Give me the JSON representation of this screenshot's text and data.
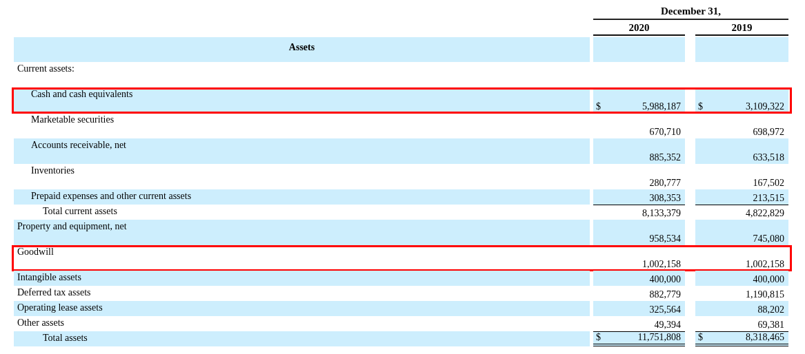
{
  "table": {
    "period_heading": "December 31,",
    "columns": [
      "2020",
      "2019"
    ],
    "rows": [
      {
        "kind": "heading",
        "label": "Assets",
        "highlighted": false
      },
      {
        "kind": "tall",
        "label": "Current assets:",
        "highlighted": false,
        "children": [
          {
            "kind": "tall",
            "label": "Cash and cash equivalents",
            "highlighted": true,
            "values": [
              {
                "sign": "$",
                "amount": "5,988,187"
              },
              {
                "sign": "$",
                "amount": "3,109,322"
              }
            ]
          },
          {
            "kind": "tall",
            "label": "Marketable securities",
            "highlighted": false,
            "values": [
              {
                "amount": "670,710"
              },
              {
                "amount": "698,972"
              }
            ]
          },
          {
            "kind": "tall",
            "label": "Accounts receivable, net",
            "highlighted": false,
            "values": [
              {
                "amount": "885,352"
              },
              {
                "amount": "633,518"
              }
            ]
          },
          {
            "kind": "tall",
            "label": "Inventories",
            "highlighted": false,
            "values": [
              {
                "amount": "280,777"
              },
              {
                "amount": "167,502"
              }
            ]
          },
          {
            "kind": "short",
            "label": "Prepaid expenses and other current assets",
            "highlighted": false,
            "values": [
              {
                "amount": "308,353"
              },
              {
                "amount": "213,515"
              }
            ]
          }
        ]
      },
      {
        "kind": "subtotal",
        "label": "Total current assets",
        "highlighted": false,
        "values": [
          {
            "amount": "8,133,379"
          },
          {
            "amount": "4,822,829"
          }
        ]
      },
      {
        "kind": "tall",
        "label": "Property and equipment, net",
        "highlighted": false,
        "values": [
          {
            "amount": "958,534"
          },
          {
            "amount": "745,080"
          }
        ]
      },
      {
        "kind": "tall",
        "label": "Goodwill",
        "highlighted": true,
        "values": [
          {
            "amount": "1,002,158"
          },
          {
            "amount": "1,002,158"
          }
        ]
      },
      {
        "kind": "short",
        "label": "Intangible assets",
        "highlighted": false,
        "values": [
          {
            "amount": "400,000"
          },
          {
            "amount": "400,000"
          }
        ]
      },
      {
        "kind": "short",
        "label": "Deferred tax assets",
        "highlighted": false,
        "values": [
          {
            "amount": "882,779"
          },
          {
            "amount": "1,190,815"
          }
        ]
      },
      {
        "kind": "short",
        "label": "Operating lease assets",
        "highlighted": false,
        "values": [
          {
            "amount": "325,564"
          },
          {
            "amount": "88,202"
          }
        ]
      },
      {
        "kind": "short",
        "label": "Other assets",
        "highlighted": false,
        "values": [
          {
            "amount": "49,394"
          },
          {
            "amount": "69,381"
          }
        ]
      },
      {
        "kind": "total",
        "label": "Total assets",
        "highlighted": false,
        "values": [
          {
            "sign": "$",
            "amount": "11,751,808"
          },
          {
            "sign": "$",
            "amount": "8,318,465"
          }
        ]
      }
    ]
  }
}
